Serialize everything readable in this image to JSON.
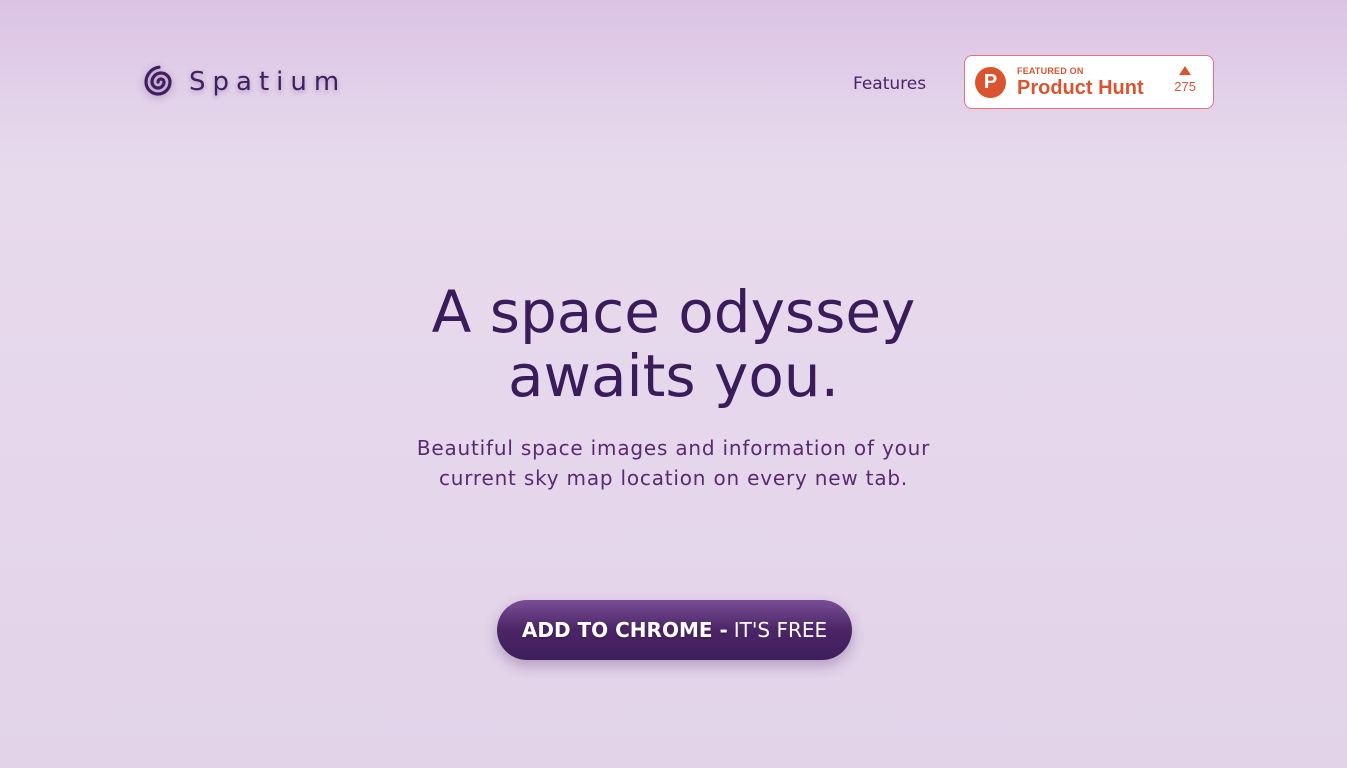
{
  "header": {
    "logo_text": "Spatium",
    "logo_icon": "spiral-logo-icon",
    "nav_features": "Features",
    "product_hunt": {
      "featured_on": "FEATURED ON",
      "name": "Product Hunt",
      "logo_letter": "P",
      "votes": "275",
      "color": "#da552f"
    }
  },
  "hero": {
    "title_line1": "A space odyssey",
    "title_line2": "awaits you.",
    "subtitle_line1": "Beautiful space images and information of your",
    "subtitle_line2": "current sky map location on every new tab."
  },
  "cta": {
    "strong": "ADD TO CHROME -",
    "light": "IT'S FREE"
  },
  "colors": {
    "primary": "#3f1f60",
    "background": "#e6d7ec",
    "accent": "#da552f"
  }
}
